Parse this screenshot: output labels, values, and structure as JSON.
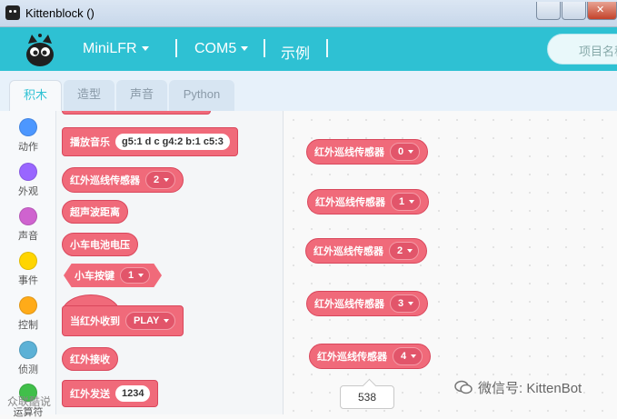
{
  "window": {
    "title": "Kittenblock ()"
  },
  "menubar": {
    "board": "MiniLFR",
    "port": "COM5",
    "examples": "示例",
    "search_placeholder": "项目名称"
  },
  "tabs": [
    "积木",
    "造型",
    "声音",
    "Python"
  ],
  "categories": [
    {
      "label": "动作",
      "color": "#4c97ff"
    },
    {
      "label": "外观",
      "color": "#9966ff"
    },
    {
      "label": "声音",
      "color": "#cf63cf"
    },
    {
      "label": "事件",
      "color": "#ffd500"
    },
    {
      "label": "控制",
      "color": "#ffab19"
    },
    {
      "label": "侦测",
      "color": "#5cb1d6"
    },
    {
      "label": "运算符",
      "color": "#40bf4a"
    }
  ],
  "palette": {
    "play_music": {
      "label": "播放音乐",
      "value": "g5:1 d c g4:2 b:1 c5:3"
    },
    "ir_line_sensor": {
      "label": "红外巡线传感器",
      "value": "2"
    },
    "ultrasonic": {
      "label": "超声波距离"
    },
    "battery": {
      "label": "小车电池电压"
    },
    "car_button": {
      "label": "小车按键",
      "value": "1"
    },
    "when_ir_received": {
      "label": "当红外收到",
      "value": "PLAY"
    },
    "ir_receive": {
      "label": "红外接收"
    },
    "ir_send": {
      "label": "红外发送",
      "value": "1234"
    }
  },
  "workspace": {
    "blocks": [
      {
        "label": "红外巡线传感器",
        "value": "0"
      },
      {
        "label": "红外巡线传感器",
        "value": "1"
      },
      {
        "label": "红外巡线传感器",
        "value": "2"
      },
      {
        "label": "红外巡线传感器",
        "value": "3"
      },
      {
        "label": "红外巡线传感器",
        "value": "4"
      }
    ],
    "tooltip": "538"
  },
  "watermarks": {
    "wechat": "微信号: KittenBot",
    "corner": "众联酷说"
  },
  "colors": {
    "menubar": "#2ec1d3",
    "block": "#f06a7a",
    "tab_active_text": "#2ec1d3"
  }
}
